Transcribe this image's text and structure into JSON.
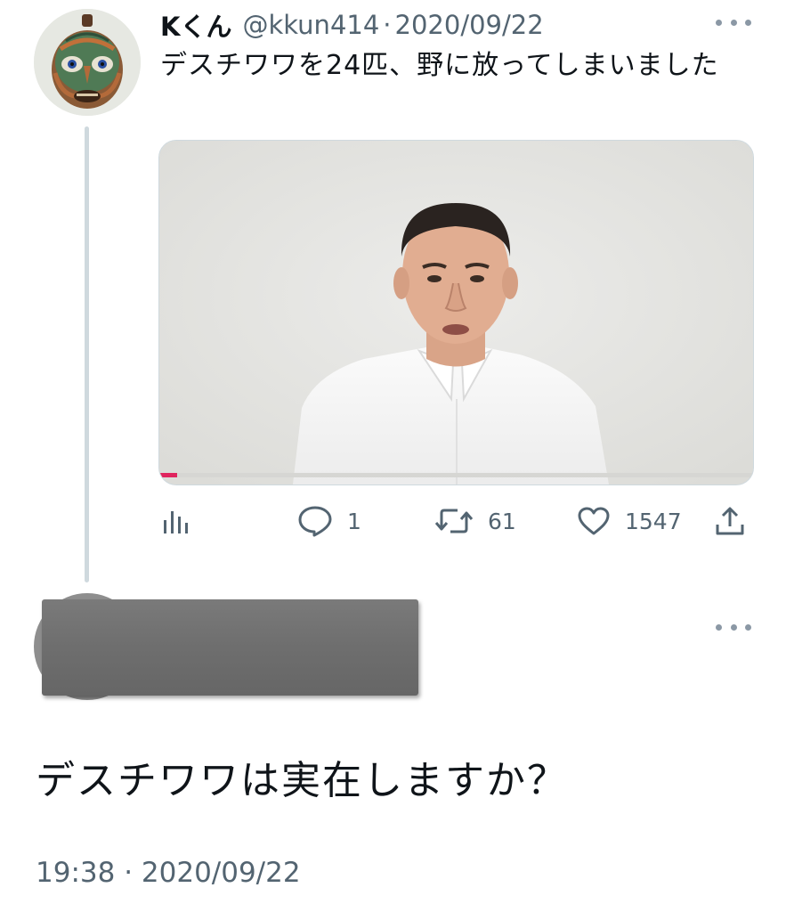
{
  "tweet": {
    "display_name": "Kくん",
    "handle": "@kkun414",
    "separator": "·",
    "date": "2020/09/22",
    "text": "デスチワワを24匹、野に放ってしまいました",
    "media": {
      "progress_percent": 3
    },
    "actions": {
      "analytics_icon": "analytics-icon",
      "reply_icon": "reply-icon",
      "reply_count": "1",
      "retweet_icon": "retweet-icon",
      "retweet_count": "61",
      "like_icon": "heart-icon",
      "like_count": "1547",
      "share_icon": "share-icon"
    }
  },
  "reply": {
    "text": "デスチワワは実在しますか？",
    "timestamp": "19:38 · 2020/09/22"
  },
  "colors": {
    "text_primary": "#0f1419",
    "text_secondary": "#536471",
    "thread_line": "#cfd9de",
    "progress_accent": "#e0245e"
  }
}
